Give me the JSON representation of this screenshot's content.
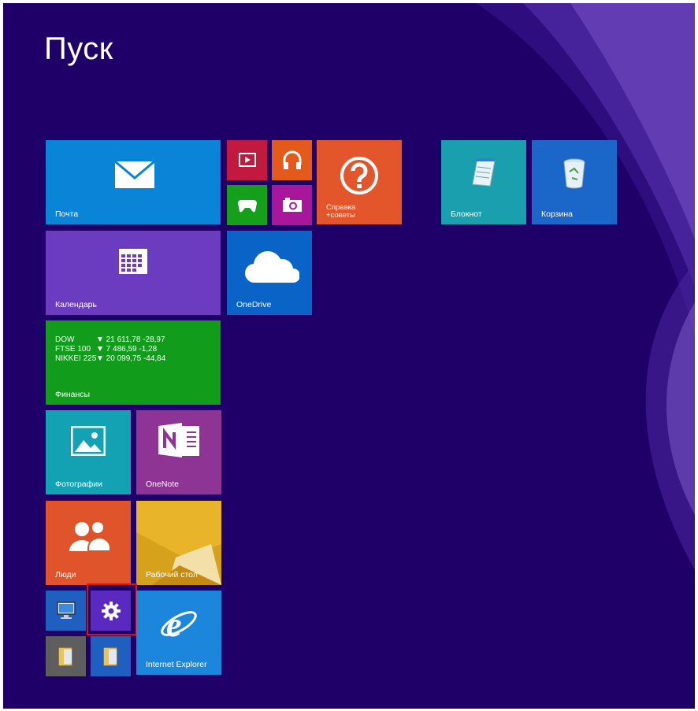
{
  "start": {
    "title": "Пуск"
  },
  "tiles": {
    "mail": {
      "label": "Почта",
      "color": "#0a84d6"
    },
    "video": {
      "label": "",
      "color": "#c21a3e"
    },
    "music": {
      "label": "",
      "color": "#e35a1a"
    },
    "games": {
      "label": "",
      "color": "#14a01a"
    },
    "camera": {
      "label": "",
      "color": "#a8169c"
    },
    "help": {
      "label_line1": "Справка",
      "label_line2": "+советы",
      "color": "#e3562b"
    },
    "notepad": {
      "label": "Блокнот",
      "color": "#1a9fae"
    },
    "recycle": {
      "label": "Корзина",
      "color": "#1b66c9"
    },
    "calendar": {
      "label": "Календарь",
      "color": "#6b3bc0"
    },
    "onedrive": {
      "label": "OneDrive",
      "color": "#0a64c8"
    },
    "finance": {
      "label": "Финансы",
      "color": "#119c1c",
      "rows": [
        {
          "name": "DOW",
          "value": "▼ 21 611,78 -28,97"
        },
        {
          "name": "FTSE 100",
          "value": "▼ 7 486,59 -1,28"
        },
        {
          "name": "NIKKEI 225",
          "value": "▼ 20 099,75 -44,84"
        }
      ]
    },
    "photos": {
      "label": "Фотографии",
      "color": "#12a2b3"
    },
    "onenote": {
      "label": "OneNote",
      "color": "#8e3494"
    },
    "people": {
      "label": "Люди",
      "color": "#e0542b"
    },
    "desktop": {
      "label": "Рабочий стол",
      "color": "#d6a21b"
    },
    "this_pc": {
      "label": "",
      "color": "#1e5fc0"
    },
    "settings": {
      "label": "",
      "color": "#5a2ac0"
    },
    "ie": {
      "label": "Internet Explorer",
      "color": "#1c86dc"
    },
    "explorer_gray": {
      "label": "",
      "color": "#5e5e5e"
    },
    "explorer_blue": {
      "label": "",
      "color": "#1e5fc0"
    }
  }
}
